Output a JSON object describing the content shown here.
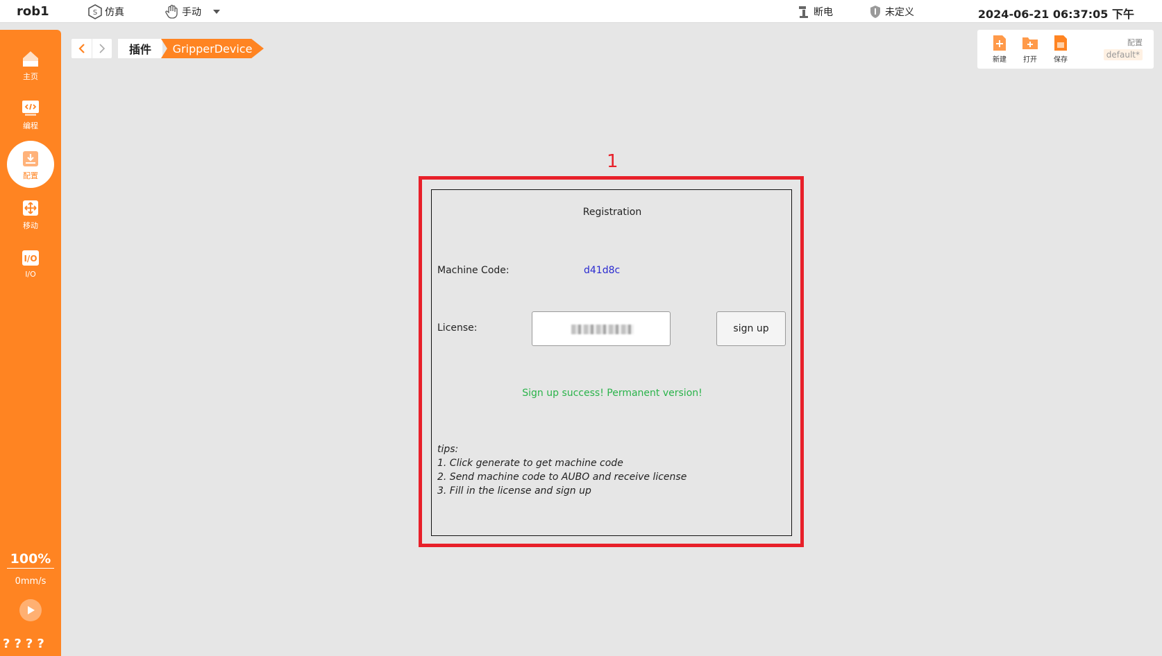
{
  "topbar": {
    "robot_name": "rob1",
    "mode_sim": "仿真",
    "mode_manual": "手动",
    "power": "断电",
    "safety": "未定义",
    "datetime": "2024-06-21 06:37:05 下午"
  },
  "sidebar": {
    "items": [
      {
        "label": "主页",
        "icon": "home-icon"
      },
      {
        "label": "编程",
        "icon": "code-icon"
      },
      {
        "label": "配置",
        "icon": "config-icon"
      },
      {
        "label": "移动",
        "icon": "move-icon"
      },
      {
        "label": "I/O",
        "icon": "io-icon"
      }
    ],
    "active_index": 2,
    "speed_percent": "100%",
    "speed_value": "0mm/s",
    "bottom_marks": "????"
  },
  "breadcrumb": {
    "plugin": "插件",
    "current": "GripperDevice"
  },
  "file_tools": {
    "new_label": "新建",
    "open_label": "打开",
    "save_label": "保存",
    "config_label": "配置",
    "config_value": "default*"
  },
  "annotation": {
    "number": "1"
  },
  "registration": {
    "title": "Registration",
    "machine_code_label": "Machine Code:",
    "machine_code_value": "d41d8c",
    "license_label": "License:",
    "signup_label": "sign up",
    "success_message": "Sign up success! Permanent version!",
    "tips": [
      "tips:",
      "1. Click generate to get machine code",
      "2. Send machine code to AUBO and receive license",
      "3. Fill in the license and sign up"
    ]
  },
  "colors": {
    "accent": "#ff8422",
    "annotation": "#e8202a",
    "success": "#2ab34a",
    "machine_code": "#2a2ad0"
  }
}
